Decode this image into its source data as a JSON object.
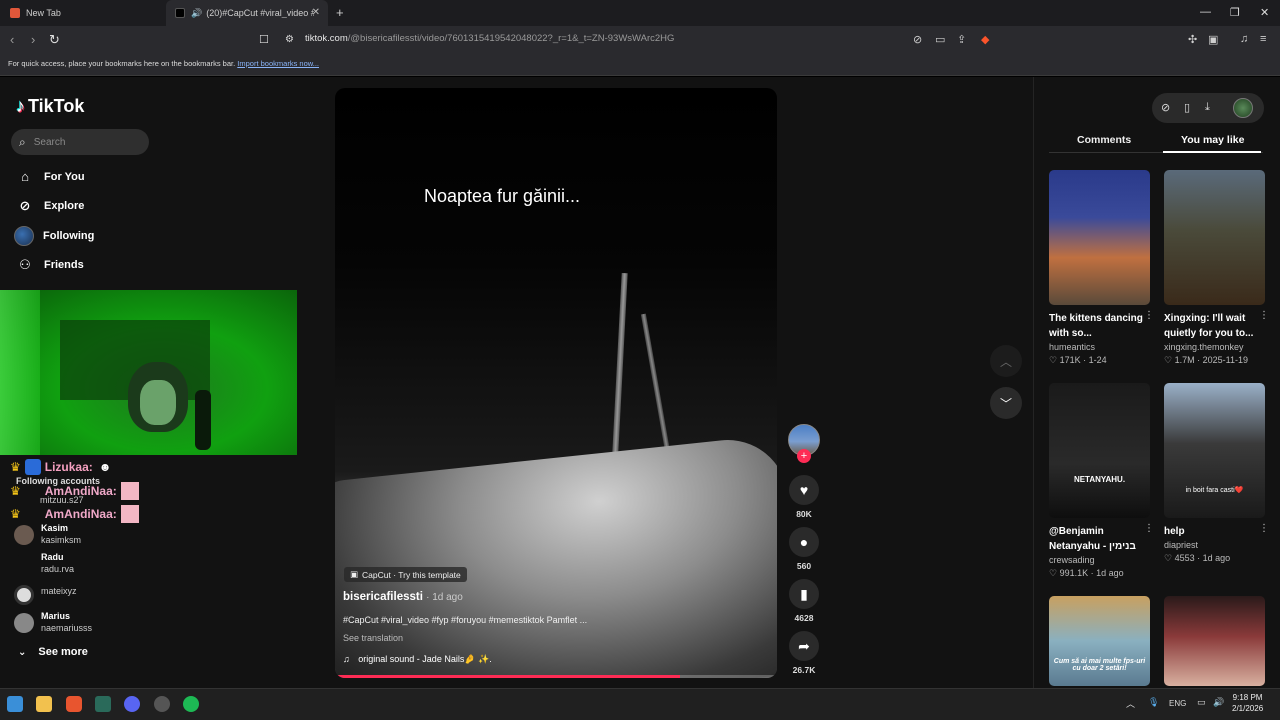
{
  "browser": {
    "tabs": [
      {
        "label": "New Tab",
        "active": false
      },
      {
        "label": "(20)#CapCut #viral_video #fyp",
        "active": true
      }
    ],
    "url_host": "tiktok.com",
    "url_rest": "/@bisericafilessti/video/7601315419542048022?_r=1&_t=ZN-93WsWArc2HG",
    "bookmarks_text": "For quick access, place your bookmarks here on the bookmarks bar.",
    "bookmarks_link": "Import bookmarks now..."
  },
  "sidebar": {
    "brand": "TikTok",
    "search_placeholder": "Search",
    "nav": [
      {
        "label": "For You",
        "icon": "home-icon"
      },
      {
        "label": "Explore",
        "icon": "compass-icon"
      },
      {
        "label": "Following",
        "icon": "following-avatar"
      },
      {
        "label": "Friends",
        "icon": "friends-icon"
      }
    ],
    "following_title": "Following accounts",
    "accounts": [
      {
        "name": "mitzuu.s27",
        "handle": ""
      },
      {
        "name": "Kasim",
        "handle": "kasimksm"
      },
      {
        "name": "Radu",
        "handle": "radu.rva"
      },
      {
        "name": "",
        "handle": "mateixyz"
      },
      {
        "name": "Marius",
        "handle": "naemariusss"
      }
    ],
    "see_more": "See more"
  },
  "chat_overlay": [
    {
      "user": "Lizukaa:"
    },
    {
      "user": "AmAndiNaa:"
    },
    {
      "user": "AmAndiNaa:"
    }
  ],
  "video": {
    "overlay_caption": "Noaptea fur găinii...",
    "template_label": "CapCut · Try this template",
    "author": "bisericafilessti",
    "posted": "· 1d ago",
    "description": "#CapCut #viral_video #fyp #foruyou #memestiktok  Pamflet ...",
    "see_translation": "See translation",
    "sound": "original sound - Jade Nails🤌 ✨.",
    "progress": 0.78,
    "actions": [
      {
        "name": "like",
        "icon": "heart-icon",
        "count": "80K"
      },
      {
        "name": "comment",
        "icon": "comment-icon",
        "count": "560"
      },
      {
        "name": "save",
        "icon": "bookmark-icon",
        "count": "4628"
      },
      {
        "name": "share",
        "icon": "share-icon",
        "count": "26.7K"
      }
    ]
  },
  "right_panel": {
    "tabs": [
      "Comments",
      "You may like"
    ],
    "active_tab": "You may like",
    "cards": [
      {
        "title": "The kittens dancing with so...",
        "user": "humeantics",
        "likes": "171K",
        "date": "1-24",
        "overlay": ""
      },
      {
        "title": "Xingxing: I'll wait quietly for you to...",
        "user": "xingxing.themonkey",
        "likes": "1.7M",
        "date": "2025-11-19",
        "overlay": ""
      },
      {
        "title": "@Benjamin Netanyahu - בנימין נתניהו",
        "user": "crewsading",
        "likes": "991.1K",
        "date": "1d ago",
        "overlay": "NETANYAHU."
      },
      {
        "title": "help",
        "user": "diapriest",
        "likes": "4553",
        "date": "1d ago",
        "overlay": "in boit fara casti❤️"
      },
      {
        "title": "",
        "user": "",
        "likes": "",
        "date": "",
        "overlay": "Cum să ai mai multe fps-uri cu doar 2 setări!"
      },
      {
        "title": "",
        "user": "",
        "likes": "",
        "date": "",
        "overlay": ""
      }
    ]
  },
  "taskbar": {
    "lang": "ENG",
    "time": "9:18 PM",
    "date": "2/1/2026"
  }
}
